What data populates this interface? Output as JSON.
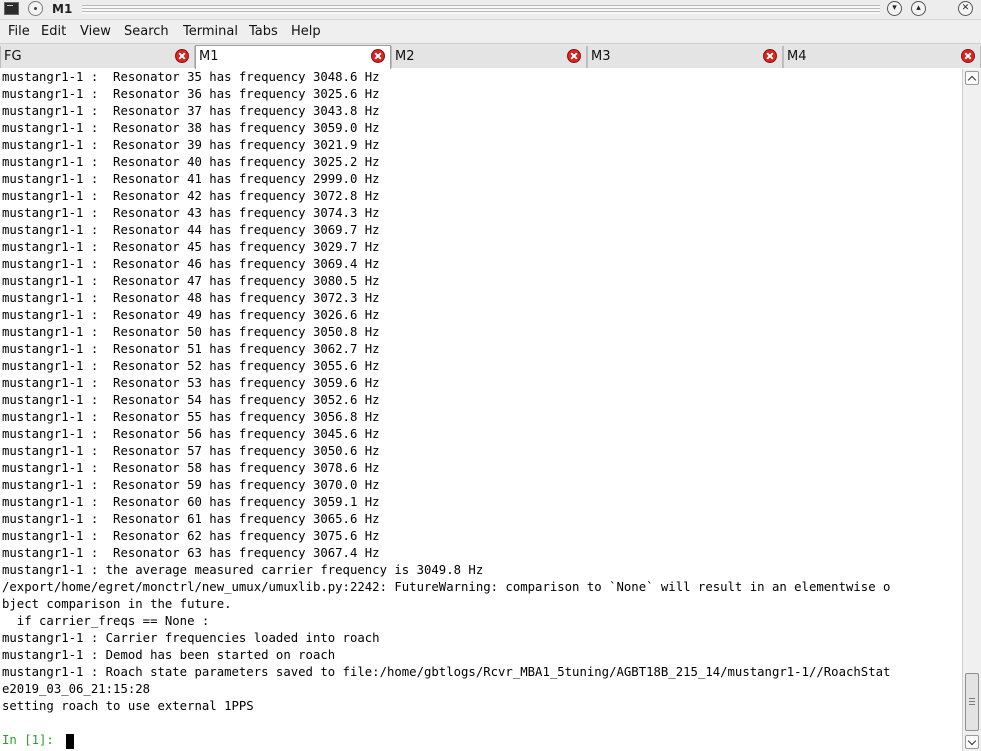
{
  "window": {
    "title": "M1"
  },
  "menu": [
    "File",
    "Edit",
    "View",
    "Search",
    "Terminal",
    "Tabs",
    "Help"
  ],
  "tabs": [
    {
      "label": "FG",
      "active": false
    },
    {
      "label": "M1",
      "active": true
    },
    {
      "label": "M2",
      "active": false
    },
    {
      "label": "M3",
      "active": false
    },
    {
      "label": "M4",
      "active": false
    }
  ],
  "terminal": {
    "lines": [
      "mustangr1-1 :  Resonator 35 has frequency 3048.6 Hz",
      "mustangr1-1 :  Resonator 36 has frequency 3025.6 Hz",
      "mustangr1-1 :  Resonator 37 has frequency 3043.8 Hz",
      "mustangr1-1 :  Resonator 38 has frequency 3059.0 Hz",
      "mustangr1-1 :  Resonator 39 has frequency 3021.9 Hz",
      "mustangr1-1 :  Resonator 40 has frequency 3025.2 Hz",
      "mustangr1-1 :  Resonator 41 has frequency 2999.0 Hz",
      "mustangr1-1 :  Resonator 42 has frequency 3072.8 Hz",
      "mustangr1-1 :  Resonator 43 has frequency 3074.3 Hz",
      "mustangr1-1 :  Resonator 44 has frequency 3069.7 Hz",
      "mustangr1-1 :  Resonator 45 has frequency 3029.7 Hz",
      "mustangr1-1 :  Resonator 46 has frequency 3069.4 Hz",
      "mustangr1-1 :  Resonator 47 has frequency 3080.5 Hz",
      "mustangr1-1 :  Resonator 48 has frequency 3072.3 Hz",
      "mustangr1-1 :  Resonator 49 has frequency 3026.6 Hz",
      "mustangr1-1 :  Resonator 50 has frequency 3050.8 Hz",
      "mustangr1-1 :  Resonator 51 has frequency 3062.7 Hz",
      "mustangr1-1 :  Resonator 52 has frequency 3055.6 Hz",
      "mustangr1-1 :  Resonator 53 has frequency 3059.6 Hz",
      "mustangr1-1 :  Resonator 54 has frequency 3052.6 Hz",
      "mustangr1-1 :  Resonator 55 has frequency 3056.8 Hz",
      "mustangr1-1 :  Resonator 56 has frequency 3045.6 Hz",
      "mustangr1-1 :  Resonator 57 has frequency 3050.6 Hz",
      "mustangr1-1 :  Resonator 58 has frequency 3078.6 Hz",
      "mustangr1-1 :  Resonator 59 has frequency 3070.0 Hz",
      "mustangr1-1 :  Resonator 60 has frequency 3059.1 Hz",
      "mustangr1-1 :  Resonator 61 has frequency 3065.6 Hz",
      "mustangr1-1 :  Resonator 62 has frequency 3075.6 Hz",
      "mustangr1-1 :  Resonator 63 has frequency 3067.4 Hz",
      "mustangr1-1 : the average measured carrier frequency is 3049.8 Hz",
      "/export/home/egret/monctrl/new_umux/umuxlib.py:2242: FutureWarning: comparison to `None` will result in an elementwise o",
      "bject comparison in the future.",
      "  if carrier_freqs == None :",
      "mustangr1-1 : Carrier frequencies loaded into roach",
      "mustangr1-1 : Demod has been started on roach",
      "mustangr1-1 : Roach state parameters saved to file:/home/gbtlogs/Rcvr_MBA1_5tuning/AGBT18B_215_14/mustangr1-1//RoachStat",
      "e2019_03_06_21:15:28",
      "setting roach to use external 1PPS"
    ],
    "prompt": "In [1]: ",
    "prompt_color": "#2e9e2e"
  }
}
